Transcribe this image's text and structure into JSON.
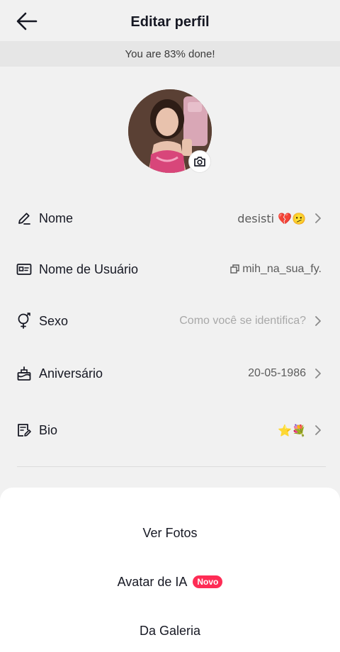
{
  "header": {
    "title": "Editar perfil"
  },
  "progress": {
    "text": "You are 83% done!",
    "percent": 83
  },
  "profile_rows": [
    {
      "label": "Nome",
      "value": "desisti 💔🫤",
      "icon": "pencil-icon"
    },
    {
      "label": "Nome de Usuário",
      "value": "mih_na_sua_fy.",
      "icon": "id-card-icon"
    },
    {
      "label": "Sexo",
      "value": "Como você se identifica?",
      "icon": "gender-icon"
    },
    {
      "label": "Aniversário",
      "value": "20-05-1986",
      "icon": "cake-icon"
    },
    {
      "label": "Bio",
      "value": "⭐💐",
      "icon": "bio-edit-icon"
    }
  ],
  "sheet": {
    "items": [
      {
        "label": "Ver Fotos"
      },
      {
        "label": "Avatar de IA",
        "badge": "Novo"
      },
      {
        "label": "Da Galeria"
      }
    ]
  },
  "colors": {
    "accent": "#fe2c55",
    "background": "#f1f1f1",
    "banner": "#e6e6e6"
  }
}
